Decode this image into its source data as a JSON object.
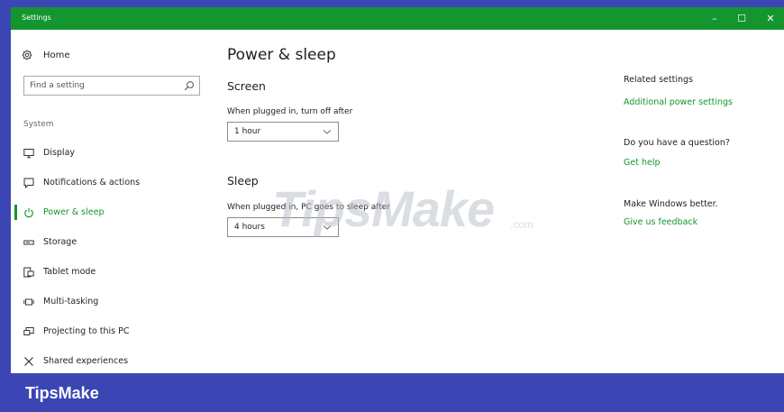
{
  "window": {
    "title": "Settings",
    "controls": {
      "minimize": "–",
      "maximize": "☐",
      "close": "✕"
    }
  },
  "sidebar": {
    "home_label": "Home",
    "search_placeholder": "Find a setting",
    "section_label": "System",
    "items": [
      {
        "label": "Display",
        "icon": "display-icon"
      },
      {
        "label": "Notifications & actions",
        "icon": "notifications-icon"
      },
      {
        "label": "Power & sleep",
        "icon": "power-icon",
        "active": true
      },
      {
        "label": "Storage",
        "icon": "storage-icon"
      },
      {
        "label": "Tablet mode",
        "icon": "tablet-mode-icon"
      },
      {
        "label": "Multi-tasking",
        "icon": "multitasking-icon"
      },
      {
        "label": "Projecting to this PC",
        "icon": "projecting-icon"
      },
      {
        "label": "Shared experiences",
        "icon": "shared-experiences-icon"
      }
    ]
  },
  "main": {
    "title": "Power & sleep",
    "screen": {
      "heading": "Screen",
      "label": "When plugged in, turn off after",
      "value": "1 hour"
    },
    "sleep": {
      "heading": "Sleep",
      "label": "When plugged in, PC goes to sleep after",
      "value": "4 hours"
    }
  },
  "related": {
    "heading": "Related settings",
    "link": "Additional power settings",
    "question": "Do you have a question?",
    "help_link": "Get help",
    "better": "Make Windows better.",
    "feedback_link": "Give us feedback"
  },
  "watermark": {
    "text": "TipsMake",
    "suffix": ".com"
  },
  "brand": {
    "text": "TipsMake"
  },
  "colors": {
    "accent": "#14952f",
    "frame": "#3b46b4"
  }
}
